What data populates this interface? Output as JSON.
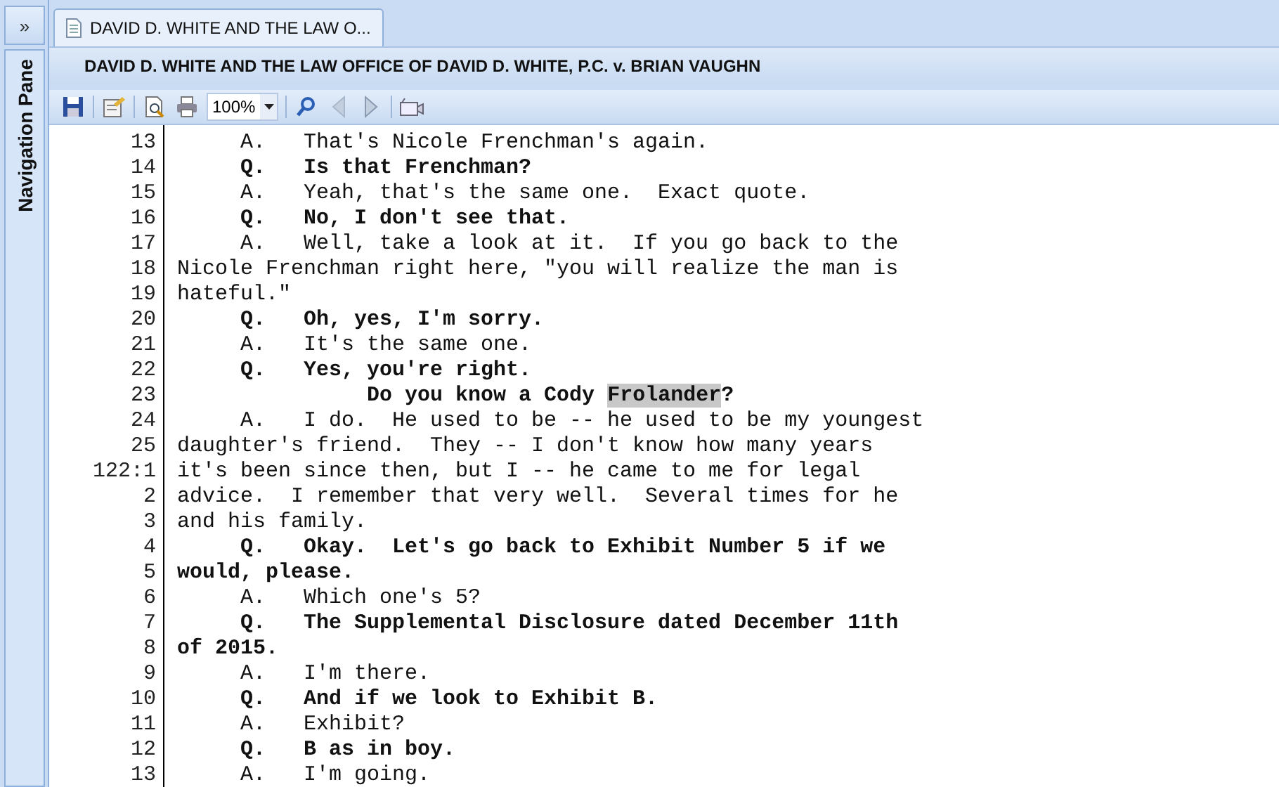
{
  "navigation_pane": {
    "expand_glyph": "»",
    "label": "Navigation Pane"
  },
  "tab": {
    "title": "DAVID D. WHITE AND THE LAW O...",
    "selected": true
  },
  "document_title": "DAVID D. WHITE AND THE LAW OFFICE OF DAVID D. WHITE, P.C. v. BRIAN VAUGHN",
  "toolbar": {
    "zoom": "100%",
    "previous_disabled": true
  },
  "lines": [
    {
      "number": "13",
      "text": "     A.   That's Nicole Frenchman's again.",
      "bold": false
    },
    {
      "number": "14",
      "text": "     Q.   Is that Frenchman?",
      "bold": true
    },
    {
      "number": "15",
      "text": "     A.   Yeah, that's the same one.  Exact quote.",
      "bold": false
    },
    {
      "number": "16",
      "text": "     Q.   No, I don't see that.",
      "bold": true
    },
    {
      "number": "17",
      "text": "     A.   Well, take a look at it.  If you go back to the",
      "bold": false
    },
    {
      "number": "18",
      "text": "Nicole Frenchman right here, \"you will realize the man is",
      "bold": false
    },
    {
      "number": "19",
      "text": "hateful.\"",
      "bold": false
    },
    {
      "number": "20",
      "text": "     Q.   Oh, yes, I'm sorry.",
      "bold": true
    },
    {
      "number": "21",
      "text": "     A.   It's the same one.",
      "bold": false
    },
    {
      "number": "22",
      "text": "     Q.   Yes, you're right.",
      "bold": true
    },
    {
      "number": "23",
      "text": "               Do you know a Cody ",
      "highlighted_text": "Frolander",
      "text_after": "?",
      "bold": true
    },
    {
      "number": "24",
      "text": "     A.   I do.  He used to be -- he used to be my youngest",
      "bold": false
    },
    {
      "number": "25",
      "text": "daughter's friend.  They -- I don't know how many years",
      "bold": false
    },
    {
      "number": "122:1",
      "text": "it's been since then, but I -- he came to me for legal",
      "bold": false
    },
    {
      "number": "2",
      "text": "advice.  I remember that very well.  Several times for he",
      "bold": false
    },
    {
      "number": "3",
      "text": "and his family.",
      "bold": false
    },
    {
      "number": "4",
      "text": "     Q.   Okay.  Let's go back to Exhibit Number 5 if we",
      "bold": true
    },
    {
      "number": "5",
      "text": "would, please.",
      "bold": true
    },
    {
      "number": "6",
      "text": "     A.   Which one's 5?",
      "bold": false
    },
    {
      "number": "7",
      "text": "     Q.   The Supplemental Disclosure dated December 11th",
      "bold": true
    },
    {
      "number": "8",
      "text": "of 2015.",
      "bold": true
    },
    {
      "number": "9",
      "text": "     A.   I'm there.",
      "bold": false
    },
    {
      "number": "10",
      "text": "     Q.   And if we look to Exhibit B.",
      "bold": true
    },
    {
      "number": "11",
      "text": "     A.   Exhibit?",
      "bold": false
    },
    {
      "number": "12",
      "text": "     Q.   B as in boy.",
      "bold": true
    },
    {
      "number": "13",
      "text": "     A.   I'm going.",
      "bold": false
    }
  ]
}
